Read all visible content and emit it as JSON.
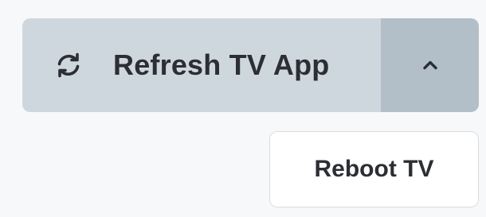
{
  "split_button": {
    "main_label": "Refresh TV App",
    "main_icon": "refresh-icon",
    "toggle_icon": "chevron-up-icon",
    "colors": {
      "main_bg": "#cfd7de",
      "toggle_bg": "#b3bfc8",
      "text": "#2c2e34"
    }
  },
  "dropdown": {
    "items": [
      {
        "label": "Reboot TV"
      }
    ]
  }
}
